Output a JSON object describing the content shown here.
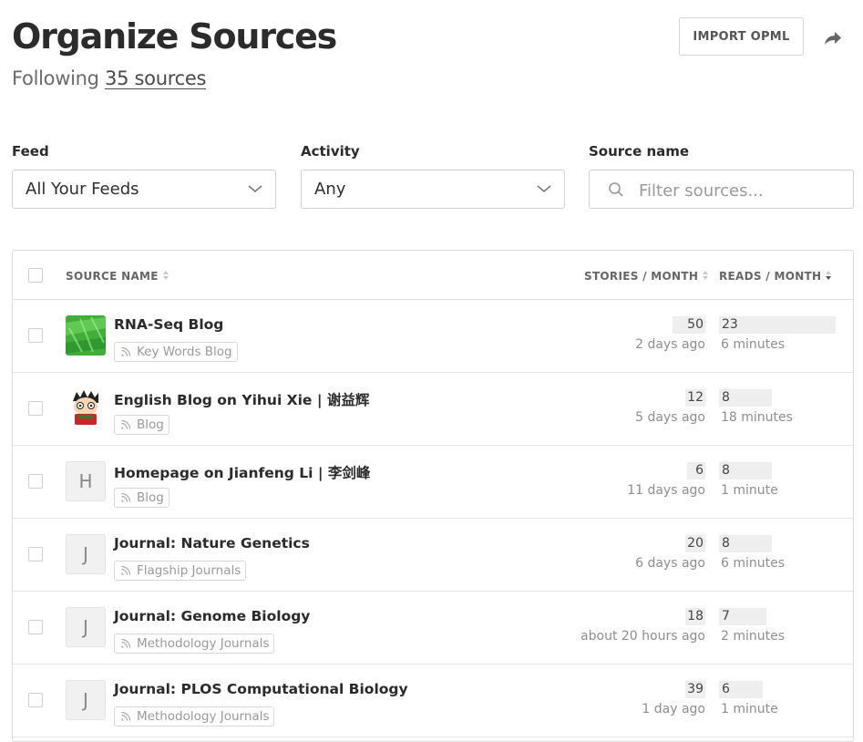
{
  "header": {
    "title": "Organize Sources",
    "following_prefix": "Following",
    "following_link": "35 sources",
    "import_label": "IMPORT OPML",
    "share_icon": "share-arrow-icon"
  },
  "filters": {
    "feed_label": "Feed",
    "feed_value": "All Your Feeds",
    "activity_label": "Activity",
    "activity_value": "Any",
    "source_label": "Source name",
    "source_placeholder": "Filter sources..."
  },
  "table": {
    "headers": {
      "source": "SOURCE NAME",
      "stories": "STORIES / MONTH",
      "reads": "READS / MONTH"
    },
    "rows": [
      {
        "name": "RNA-Seq Blog",
        "tag": "Key Words Blog",
        "stories": "50",
        "stories_fill": 0.16,
        "updated": "2 days ago",
        "reads": "23",
        "reads_fill": 1.0,
        "read_time": "6 minutes",
        "avatar": "image",
        "avatar_letter": ""
      },
      {
        "name": "English Blog on Yihui Xie | 谢益辉",
        "tag": "Blog",
        "stories": "12",
        "stories_fill": 0.0,
        "updated": "5 days ago",
        "reads": "8",
        "reads_fill": 0.35,
        "read_time": "18 minutes",
        "avatar": "cartoon",
        "avatar_letter": ""
      },
      {
        "name": "Homepage on Jianfeng Li | 李剑峰",
        "tag": "Blog",
        "stories": "6",
        "stories_fill": 0.0,
        "updated": "11 days ago",
        "reads": "8",
        "reads_fill": 0.35,
        "read_time": "1 minute",
        "avatar": "letter",
        "avatar_letter": "H"
      },
      {
        "name": "Journal: Nature Genetics",
        "tag": "Flagship Journals",
        "stories": "20",
        "stories_fill": 0.0,
        "updated": "6 days ago",
        "reads": "8",
        "reads_fill": 0.35,
        "read_time": "6 minutes",
        "avatar": "letter",
        "avatar_letter": "J"
      },
      {
        "name": "Journal: Genome Biology",
        "tag": "Methodology Journals",
        "stories": "18",
        "stories_fill": 0.0,
        "updated": "about 20 hours ago",
        "reads": "7",
        "reads_fill": 0.3,
        "read_time": "2 minutes",
        "avatar": "letter",
        "avatar_letter": "J"
      },
      {
        "name": "Journal: PLOS Computational Biology",
        "tag": "Methodology Journals",
        "stories": "39",
        "stories_fill": 0.0,
        "updated": "1 day ago",
        "reads": "6",
        "reads_fill": 0.26,
        "read_time": "1 minute",
        "avatar": "letter",
        "avatar_letter": "J"
      }
    ]
  },
  "colors": {
    "accent_green": "#3fae3a",
    "bar_bg": "#eeeeee",
    "muted_text": "#8e8e8e"
  }
}
